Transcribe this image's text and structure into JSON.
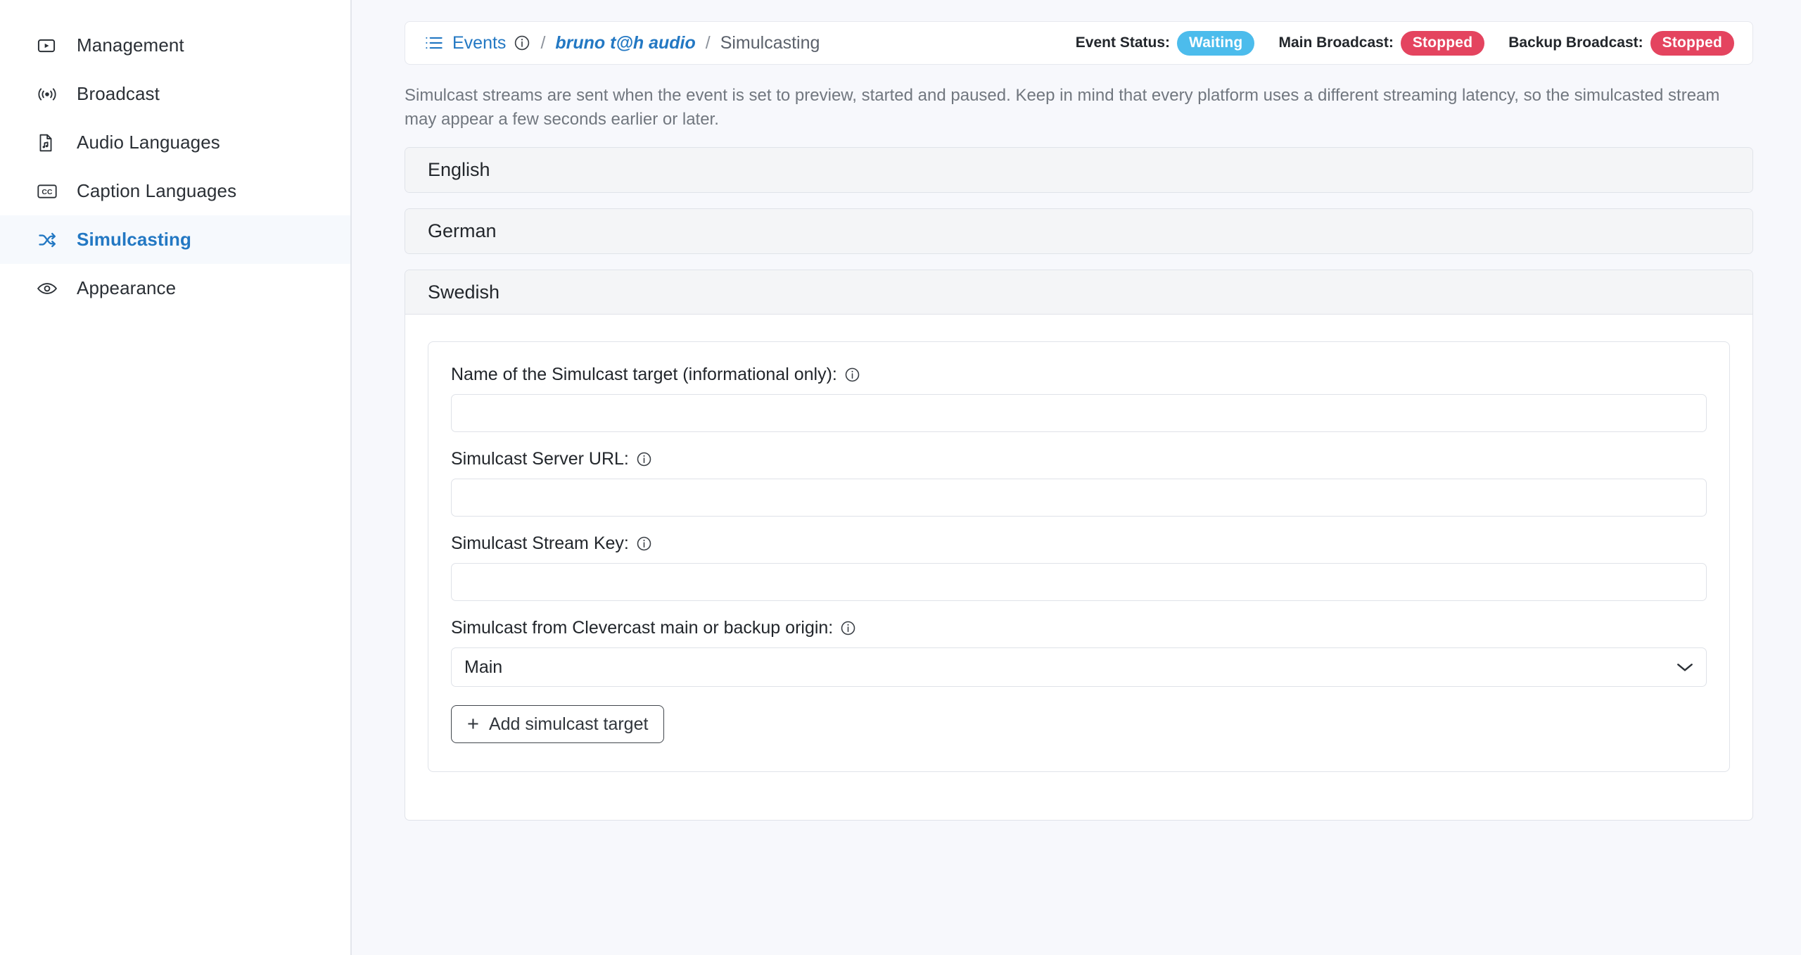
{
  "sidebar": {
    "items": [
      {
        "label": "Management",
        "icon": "video-play-icon",
        "active": false
      },
      {
        "label": "Broadcast",
        "icon": "broadcast-icon",
        "active": false
      },
      {
        "label": "Audio Languages",
        "icon": "audio-file-icon",
        "active": false
      },
      {
        "label": "Caption Languages",
        "icon": "closed-caption-icon",
        "active": false
      },
      {
        "label": "Simulcasting",
        "icon": "shuffle-icon",
        "active": true
      },
      {
        "label": "Appearance",
        "icon": "eye-icon",
        "active": false
      }
    ]
  },
  "breadcrumb": {
    "list_icon": "list-icon",
    "root": "Events",
    "root_info_icon": "info-icon",
    "separator": "/",
    "event": "bruno t@h audio",
    "current": "Simulcasting"
  },
  "status": {
    "event": {
      "label": "Event Status:",
      "value": "Waiting",
      "color": "#4cbcec"
    },
    "main": {
      "label": "Main Broadcast:",
      "value": "Stopped",
      "color": "#e4445f"
    },
    "backup": {
      "label": "Backup Broadcast:",
      "value": "Stopped",
      "color": "#e4445f"
    }
  },
  "description": "Simulcast streams are sent when the event is set to preview, started and paused. Keep in mind that every platform uses a different streaming latency, so the simulcasted stream may appear a few seconds earlier or later.",
  "panels": [
    {
      "title": "English",
      "expanded": false
    },
    {
      "title": "German",
      "expanded": false
    },
    {
      "title": "Swedish",
      "expanded": true
    }
  ],
  "form": {
    "name": {
      "label": "Name of the Simulcast target (informational only):",
      "info_icon": "info-icon",
      "value": "",
      "placeholder": ""
    },
    "server_url": {
      "label": "Simulcast Server URL:",
      "info_icon": "info-icon",
      "value": "",
      "placeholder": ""
    },
    "stream_key": {
      "label": "Simulcast Stream Key:",
      "info_icon": "info-icon",
      "value": "",
      "placeholder": ""
    },
    "origin": {
      "label": "Simulcast from Clevercast main or backup origin:",
      "info_icon": "info-icon",
      "value": "Main",
      "chevron_icon": "chevron-down-icon"
    },
    "add_button": {
      "label": "Add simulcast target",
      "plus": "+"
    }
  }
}
